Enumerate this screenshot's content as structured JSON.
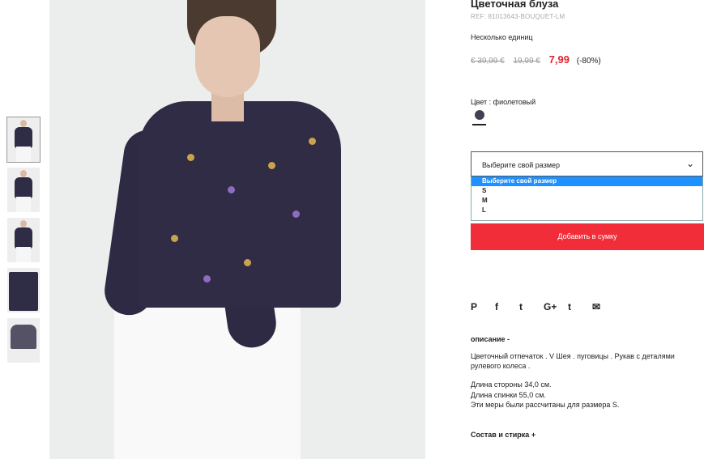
{
  "product": {
    "title": "Цветочная блуза",
    "ref": "REF: 81013643-BOUQUET-LM",
    "availability": "Несколько единиц",
    "price_old_1": "€ 39,99 €",
    "price_old_2": "19,99 €",
    "price_new": "7,99",
    "discount": "(-80%)",
    "color_label": "Цвет : фиолетовый",
    "color_hex": "#3f4052"
  },
  "size_select": {
    "value": "Выберите свой размер",
    "options": [
      "Выберите свой размер",
      "S",
      "M",
      "L"
    ]
  },
  "add_to_bag": "Добавить в сумку",
  "social": [
    "P",
    "f",
    "t",
    "G+",
    "t",
    "✉"
  ],
  "description": {
    "heading": "описание -",
    "text": "Цветочный отпечаток . V Шея . пуговицы . Рукав с деталями рулевого колеса .",
    "measure_1": "Длина стороны 34,0 см.",
    "measure_2": "Длина спинки 55,0 см.",
    "measure_3": "Эти меры были рассчитаны для размера S."
  },
  "composition": "Состав и стирка +"
}
